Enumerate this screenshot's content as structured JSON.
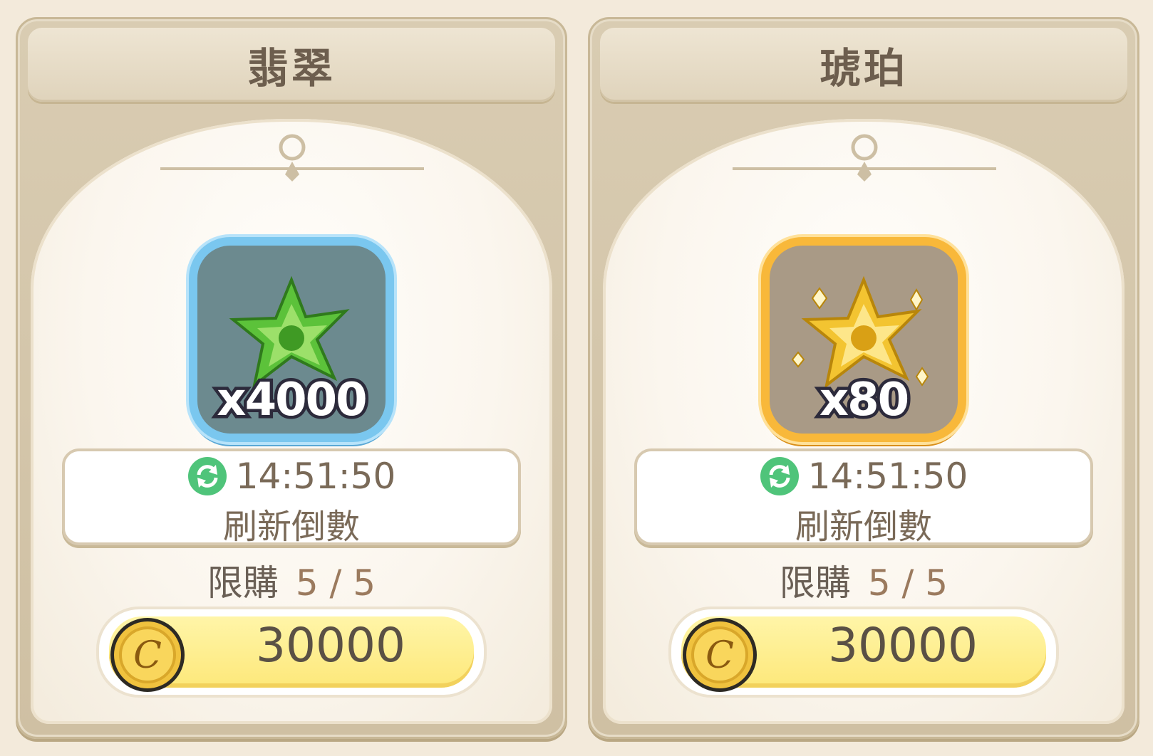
{
  "cards": [
    {
      "name": "翡翠",
      "item_icon": "green-crystal-star-icon",
      "quantity": "x4000",
      "timer": "14:51:50",
      "refresh_label": "刷新倒數",
      "limit_label": "限購",
      "limit_count": "5 / 5",
      "currency_icon": "gold-coin-icon",
      "price": "30000",
      "frame_color": "#7ac7ef"
    },
    {
      "name": "琥珀",
      "item_icon": "gold-crystal-star-icon",
      "quantity": "x80",
      "timer": "14:51:50",
      "refresh_label": "刷新倒數",
      "limit_label": "限購",
      "limit_count": "5 / 5",
      "currency_icon": "gold-coin-icon",
      "price": "30000",
      "frame_color": "#f8b83a"
    }
  ]
}
